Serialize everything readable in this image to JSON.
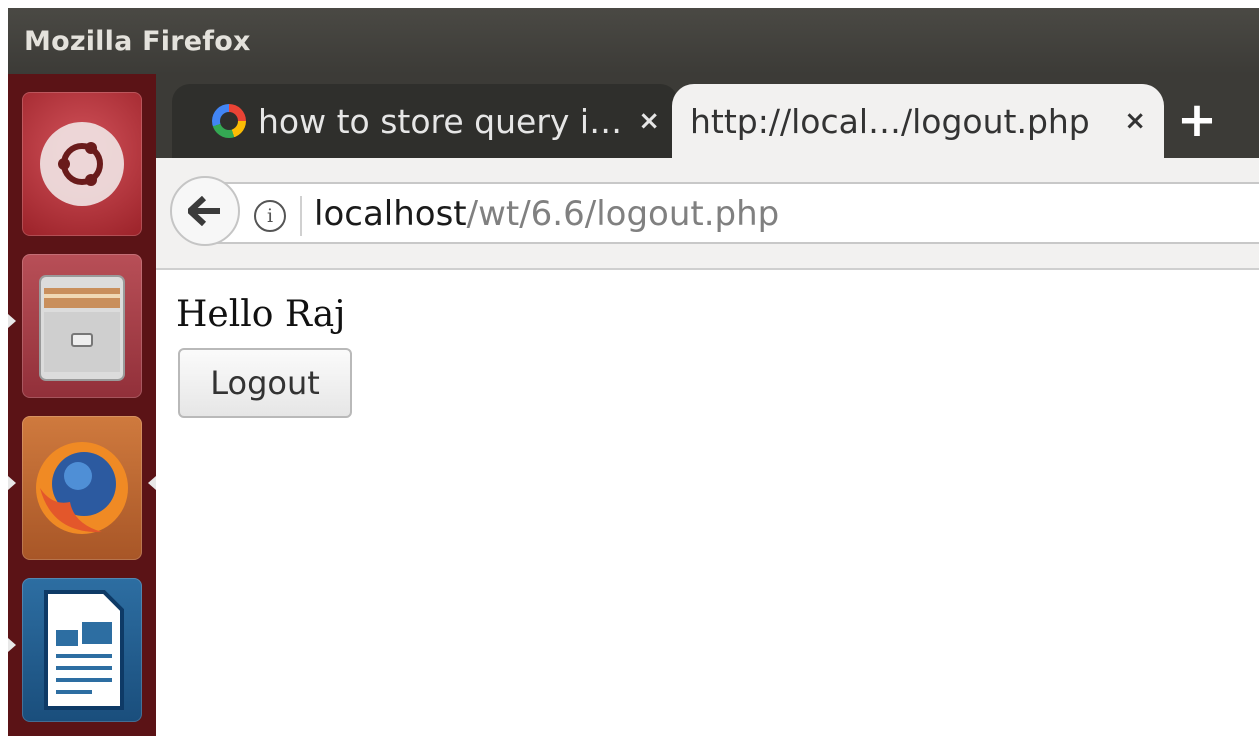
{
  "window": {
    "title": "Mozilla Firefox"
  },
  "launcher": {
    "items": [
      {
        "name": "ubuntu",
        "icon": "ubuntu-logo-icon"
      },
      {
        "name": "files",
        "icon": "file-cabinet-icon"
      },
      {
        "name": "firefox",
        "icon": "firefox-icon"
      },
      {
        "name": "writer",
        "icon": "libreoffice-writer-icon"
      }
    ]
  },
  "tabs": [
    {
      "label": "how to store query i…",
      "close": "×",
      "icon": "google-icon",
      "active": false
    },
    {
      "label": "http://local…/logout.php",
      "close": "×",
      "active": true
    }
  ],
  "newtab": {
    "label": "+"
  },
  "navbar": {
    "back_icon": "🡐",
    "info_icon": "i",
    "url_host": "localhost",
    "url_path": "/wt/6.6/logout.php"
  },
  "page": {
    "greeting": "Hello Raj",
    "logout_label": "Logout"
  },
  "colors": {
    "titlebar": "#3c3b37",
    "launcher": "#5b1316",
    "active_tab": "#f2f1f0"
  }
}
